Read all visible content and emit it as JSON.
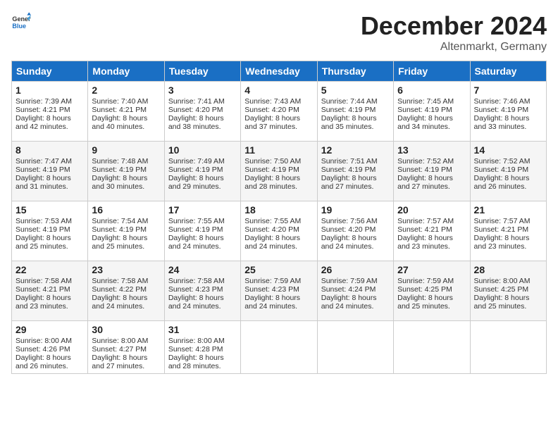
{
  "header": {
    "logo_general": "General",
    "logo_blue": "Blue",
    "month": "December 2024",
    "location": "Altenmarkt, Germany"
  },
  "days_of_week": [
    "Sunday",
    "Monday",
    "Tuesday",
    "Wednesday",
    "Thursday",
    "Friday",
    "Saturday"
  ],
  "weeks": [
    [
      {
        "day": "1",
        "lines": [
          "Sunrise: 7:39 AM",
          "Sunset: 4:21 PM",
          "Daylight: 8 hours",
          "and 42 minutes."
        ]
      },
      {
        "day": "2",
        "lines": [
          "Sunrise: 7:40 AM",
          "Sunset: 4:21 PM",
          "Daylight: 8 hours",
          "and 40 minutes."
        ]
      },
      {
        "day": "3",
        "lines": [
          "Sunrise: 7:41 AM",
          "Sunset: 4:20 PM",
          "Daylight: 8 hours",
          "and 38 minutes."
        ]
      },
      {
        "day": "4",
        "lines": [
          "Sunrise: 7:43 AM",
          "Sunset: 4:20 PM",
          "Daylight: 8 hours",
          "and 37 minutes."
        ]
      },
      {
        "day": "5",
        "lines": [
          "Sunrise: 7:44 AM",
          "Sunset: 4:19 PM",
          "Daylight: 8 hours",
          "and 35 minutes."
        ]
      },
      {
        "day": "6",
        "lines": [
          "Sunrise: 7:45 AM",
          "Sunset: 4:19 PM",
          "Daylight: 8 hours",
          "and 34 minutes."
        ]
      },
      {
        "day": "7",
        "lines": [
          "Sunrise: 7:46 AM",
          "Sunset: 4:19 PM",
          "Daylight: 8 hours",
          "and 33 minutes."
        ]
      }
    ],
    [
      {
        "day": "8",
        "lines": [
          "Sunrise: 7:47 AM",
          "Sunset: 4:19 PM",
          "Daylight: 8 hours",
          "and 31 minutes."
        ]
      },
      {
        "day": "9",
        "lines": [
          "Sunrise: 7:48 AM",
          "Sunset: 4:19 PM",
          "Daylight: 8 hours",
          "and 30 minutes."
        ]
      },
      {
        "day": "10",
        "lines": [
          "Sunrise: 7:49 AM",
          "Sunset: 4:19 PM",
          "Daylight: 8 hours",
          "and 29 minutes."
        ]
      },
      {
        "day": "11",
        "lines": [
          "Sunrise: 7:50 AM",
          "Sunset: 4:19 PM",
          "Daylight: 8 hours",
          "and 28 minutes."
        ]
      },
      {
        "day": "12",
        "lines": [
          "Sunrise: 7:51 AM",
          "Sunset: 4:19 PM",
          "Daylight: 8 hours",
          "and 27 minutes."
        ]
      },
      {
        "day": "13",
        "lines": [
          "Sunrise: 7:52 AM",
          "Sunset: 4:19 PM",
          "Daylight: 8 hours",
          "and 27 minutes."
        ]
      },
      {
        "day": "14",
        "lines": [
          "Sunrise: 7:52 AM",
          "Sunset: 4:19 PM",
          "Daylight: 8 hours",
          "and 26 minutes."
        ]
      }
    ],
    [
      {
        "day": "15",
        "lines": [
          "Sunrise: 7:53 AM",
          "Sunset: 4:19 PM",
          "Daylight: 8 hours",
          "and 25 minutes."
        ]
      },
      {
        "day": "16",
        "lines": [
          "Sunrise: 7:54 AM",
          "Sunset: 4:19 PM",
          "Daylight: 8 hours",
          "and 25 minutes."
        ]
      },
      {
        "day": "17",
        "lines": [
          "Sunrise: 7:55 AM",
          "Sunset: 4:19 PM",
          "Daylight: 8 hours",
          "and 24 minutes."
        ]
      },
      {
        "day": "18",
        "lines": [
          "Sunrise: 7:55 AM",
          "Sunset: 4:20 PM",
          "Daylight: 8 hours",
          "and 24 minutes."
        ]
      },
      {
        "day": "19",
        "lines": [
          "Sunrise: 7:56 AM",
          "Sunset: 4:20 PM",
          "Daylight: 8 hours",
          "and 24 minutes."
        ]
      },
      {
        "day": "20",
        "lines": [
          "Sunrise: 7:57 AM",
          "Sunset: 4:21 PM",
          "Daylight: 8 hours",
          "and 23 minutes."
        ]
      },
      {
        "day": "21",
        "lines": [
          "Sunrise: 7:57 AM",
          "Sunset: 4:21 PM",
          "Daylight: 8 hours",
          "and 23 minutes."
        ]
      }
    ],
    [
      {
        "day": "22",
        "lines": [
          "Sunrise: 7:58 AM",
          "Sunset: 4:21 PM",
          "Daylight: 8 hours",
          "and 23 minutes."
        ]
      },
      {
        "day": "23",
        "lines": [
          "Sunrise: 7:58 AM",
          "Sunset: 4:22 PM",
          "Daylight: 8 hours",
          "and 24 minutes."
        ]
      },
      {
        "day": "24",
        "lines": [
          "Sunrise: 7:58 AM",
          "Sunset: 4:23 PM",
          "Daylight: 8 hours",
          "and 24 minutes."
        ]
      },
      {
        "day": "25",
        "lines": [
          "Sunrise: 7:59 AM",
          "Sunset: 4:23 PM",
          "Daylight: 8 hours",
          "and 24 minutes."
        ]
      },
      {
        "day": "26",
        "lines": [
          "Sunrise: 7:59 AM",
          "Sunset: 4:24 PM",
          "Daylight: 8 hours",
          "and 24 minutes."
        ]
      },
      {
        "day": "27",
        "lines": [
          "Sunrise: 7:59 AM",
          "Sunset: 4:25 PM",
          "Daylight: 8 hours",
          "and 25 minutes."
        ]
      },
      {
        "day": "28",
        "lines": [
          "Sunrise: 8:00 AM",
          "Sunset: 4:25 PM",
          "Daylight: 8 hours",
          "and 25 minutes."
        ]
      }
    ],
    [
      {
        "day": "29",
        "lines": [
          "Sunrise: 8:00 AM",
          "Sunset: 4:26 PM",
          "Daylight: 8 hours",
          "and 26 minutes."
        ]
      },
      {
        "day": "30",
        "lines": [
          "Sunrise: 8:00 AM",
          "Sunset: 4:27 PM",
          "Daylight: 8 hours",
          "and 27 minutes."
        ]
      },
      {
        "day": "31",
        "lines": [
          "Sunrise: 8:00 AM",
          "Sunset: 4:28 PM",
          "Daylight: 8 hours",
          "and 28 minutes."
        ]
      },
      null,
      null,
      null,
      null
    ]
  ]
}
